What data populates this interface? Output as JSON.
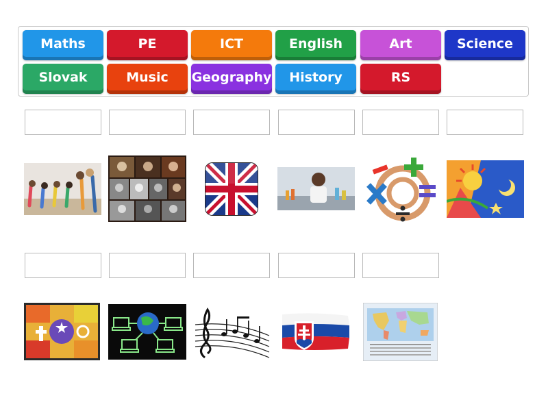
{
  "word_bank": [
    {
      "label": "Maths",
      "color": "#2196e8"
    },
    {
      "label": "PE",
      "color": "#d4192c"
    },
    {
      "label": "ICT",
      "color": "#f47a0c"
    },
    {
      "label": "English",
      "color": "#21a047"
    },
    {
      "label": "Art",
      "color": "#c752d8"
    },
    {
      "label": "Science",
      "color": "#1e37c8"
    },
    {
      "label": "Slovak",
      "color": "#2ba866"
    },
    {
      "label": "Music",
      "color": "#e8420e"
    },
    {
      "label": "Geography",
      "color": "#8a32e0"
    },
    {
      "label": "History",
      "color": "#2196e8"
    },
    {
      "label": "RS",
      "color": "#d4192c"
    }
  ],
  "row1_images": [
    "pe-exercise-photo",
    "history-portraits-collage",
    "union-jack-flag",
    "science-lab-photo",
    "maths-symbols",
    "art-sun-drawing"
  ],
  "row2_images": [
    "religions-symbols-puzzle",
    "ict-computer-network",
    "music-notes",
    "slovak-flag",
    "world-map"
  ]
}
